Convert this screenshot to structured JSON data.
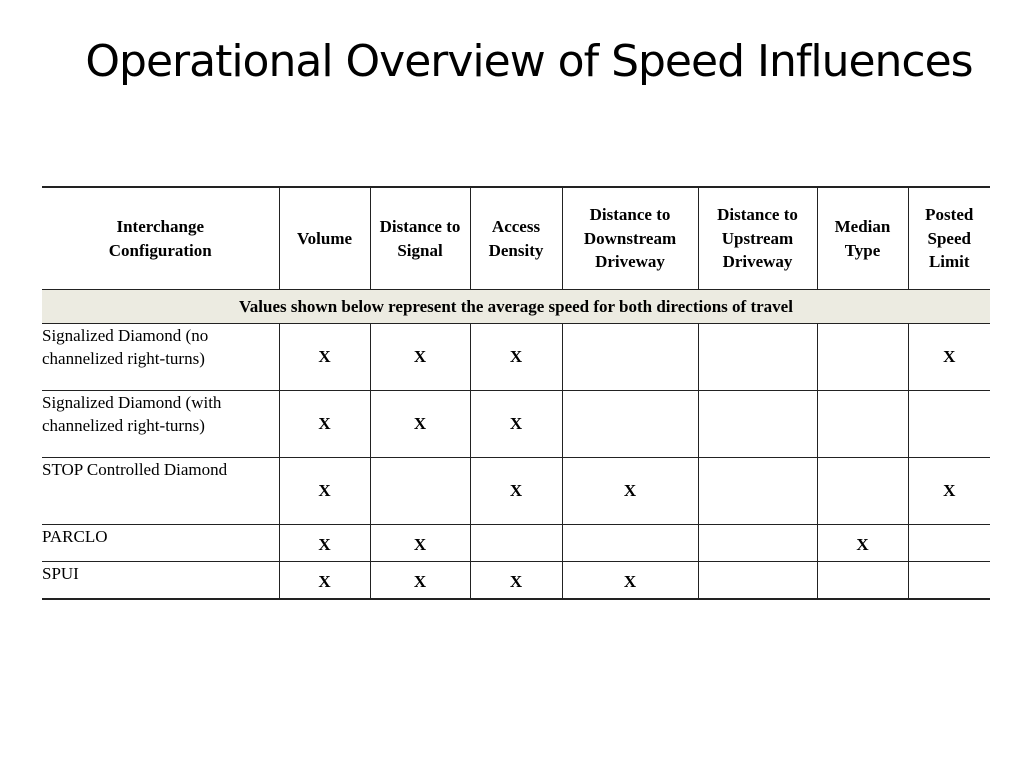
{
  "slide": {
    "title": "Operational Overview of Speed Influences"
  },
  "table": {
    "headers": [
      "Interchange Configuration",
      "Volume",
      "Distance to Signal",
      "Access Density",
      "Distance to Downstream Driveway",
      "Distance to Upstream Driveway",
      "Median Type",
      "Posted Speed Limit"
    ],
    "banner": "Values shown below represent the average speed for both directions of travel",
    "rows": [
      {
        "config": "Signalized Diamond (no channelized right-turns)",
        "cells": [
          "X",
          "X",
          "X",
          "",
          "",
          "",
          "X"
        ]
      },
      {
        "config": "Signalized Diamond (with channelized right-turns)",
        "cells": [
          "X",
          "X",
          "X",
          "",
          "",
          "",
          ""
        ]
      },
      {
        "config": "STOP Controlled Diamond",
        "cells": [
          "X",
          "",
          "X",
          "X",
          "",
          "",
          "X"
        ]
      },
      {
        "config": "PARCLO",
        "cells": [
          "X",
          "X",
          "",
          "",
          "",
          "X",
          ""
        ]
      },
      {
        "config": "SPUI",
        "cells": [
          "X",
          "X",
          "X",
          "X",
          "",
          "",
          ""
        ]
      }
    ]
  }
}
